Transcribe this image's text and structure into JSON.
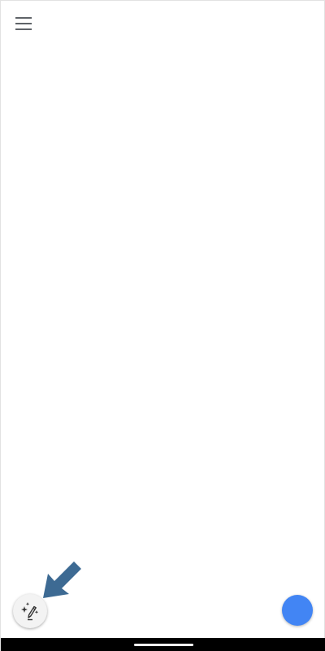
{
  "icons": {
    "menu": "hamburger-menu-icon",
    "assist": "sparkle-pen-icon",
    "callout": "arrow-callout-icon"
  },
  "colors": {
    "fab": "#4285F4",
    "callout_arrow": "#3D6A93",
    "menu_icon": "#5f6368",
    "nav_bar": "#000000"
  }
}
